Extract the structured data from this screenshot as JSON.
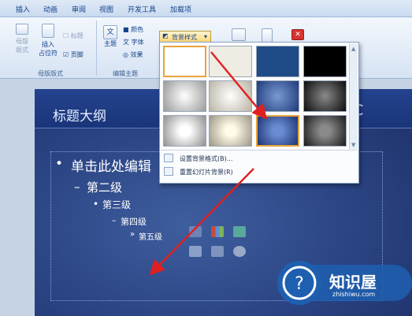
{
  "ribbon": {
    "tabs": [
      "插入",
      "动画",
      "审阅",
      "视图",
      "开发工具",
      "加载项"
    ],
    "master_layout": {
      "buttons": {
        "master_layout": "母版\n版式",
        "insert_placeholder": "插入\n占位符",
        "title": "标题",
        "footer": "页脚"
      },
      "group_label": "母版版式"
    },
    "edit_theme": {
      "theme": "主题",
      "colors": "颜色",
      "fonts": "字体",
      "effects": "效果",
      "group_label": "编辑主题"
    },
    "background_styles_label": "背景样式"
  },
  "dropdown": {
    "menu_items": [
      "设置背景格式(B)...",
      "重置幻灯片背景(R)"
    ]
  },
  "slide": {
    "title": "标题大纲",
    "right_letter": "C",
    "levels": [
      "单击此处编辑",
      "第二级",
      "第三级",
      "第四级",
      "第五级"
    ]
  },
  "watermark": {
    "brand": "知识屋",
    "url": "zhishiwu.com"
  },
  "colors": {
    "arrow": "#e02020",
    "accent": "#1f5fb0"
  }
}
